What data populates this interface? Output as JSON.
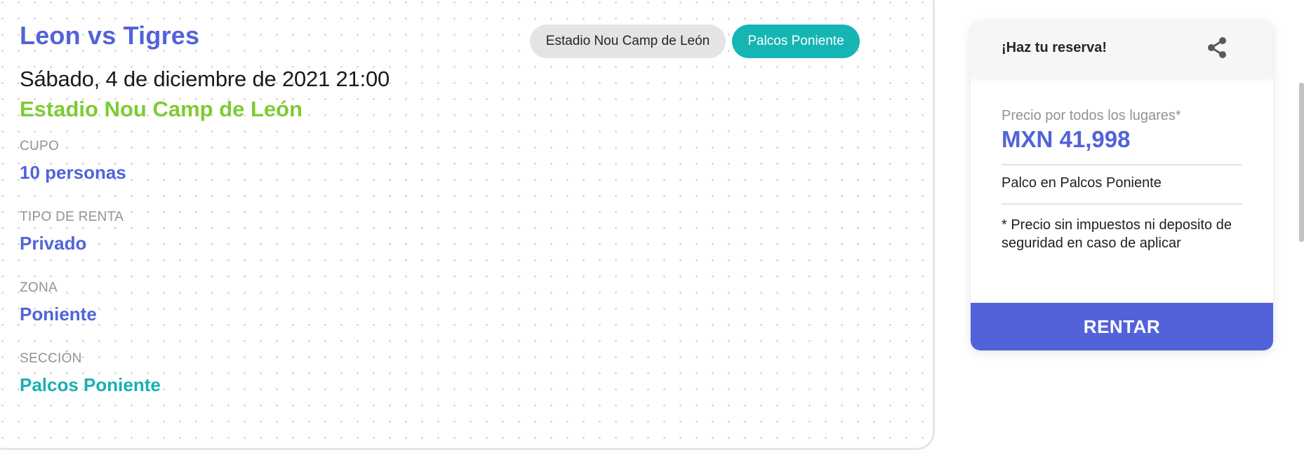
{
  "event": {
    "title": "Leon vs Tigres",
    "datetime": "Sábado, 4 de diciembre de 2021 21:00",
    "venue": "Estadio Nou Camp de León",
    "fields": {
      "capacity": {
        "label": "CUPO",
        "value": "10 personas"
      },
      "rent_type": {
        "label": "TIPO DE RENTA",
        "value": "Privado"
      },
      "zone": {
        "label": "ZONA",
        "value": "Poniente"
      },
      "section": {
        "label": "SECCIÓN",
        "value": "Palcos Poniente"
      }
    },
    "chips": {
      "stadium": "Estadio Nou Camp de León",
      "zone": "Palcos Poniente"
    }
  },
  "booking": {
    "header_title": "¡Haz tu reserva!",
    "price_label": "Precio por todos los lugares*",
    "price_value": "MXN 41,998",
    "detail": "Palco en Palcos Poniente",
    "disclaimer": "* Precio sin impuestos ni deposito de seguridad en caso de aplicar",
    "button_label": "RENTAR"
  },
  "icons": {
    "share": "share-icon"
  },
  "colors": {
    "primary": "#5263d9",
    "accent_green": "#7ecb34",
    "teal": "#17b0b2",
    "chip_teal": "#14b5b3",
    "chip_gray": "#e4e4e4",
    "muted_text": "#8f929a"
  }
}
